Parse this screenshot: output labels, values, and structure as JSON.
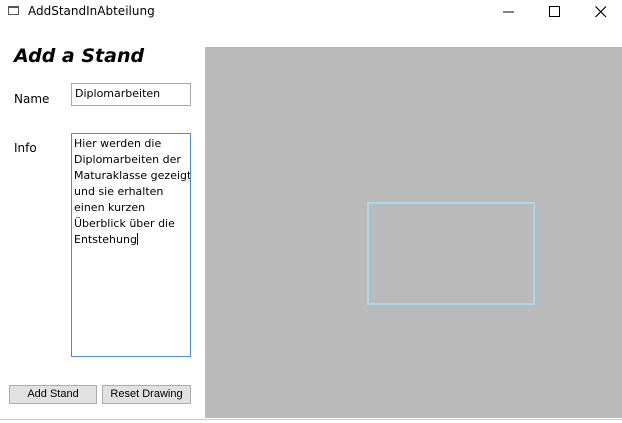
{
  "window": {
    "title": "AddStandInAbteilung",
    "controls": [
      "minimize-icon",
      "maximize-icon",
      "close-icon"
    ]
  },
  "form": {
    "heading": "Add a Stand",
    "name_label": "Name",
    "name_value": "Diplomarbeiten",
    "info_label": "Info",
    "info_lines": [
      "Hier werden die",
      "Diplomarbeiten der",
      "Maturaklasse gezeigt",
      "und sie erhalten",
      "einen kurzen",
      "Überblick über die",
      "Entstehung"
    ]
  },
  "buttons": {
    "add_stand": "Add Stand",
    "reset_drawing": "Reset Drawing"
  },
  "colors": {
    "canvas_bg": "#bababa",
    "drawn_rect": "#a9d8ee",
    "focus_border": "#4a8cd6"
  }
}
